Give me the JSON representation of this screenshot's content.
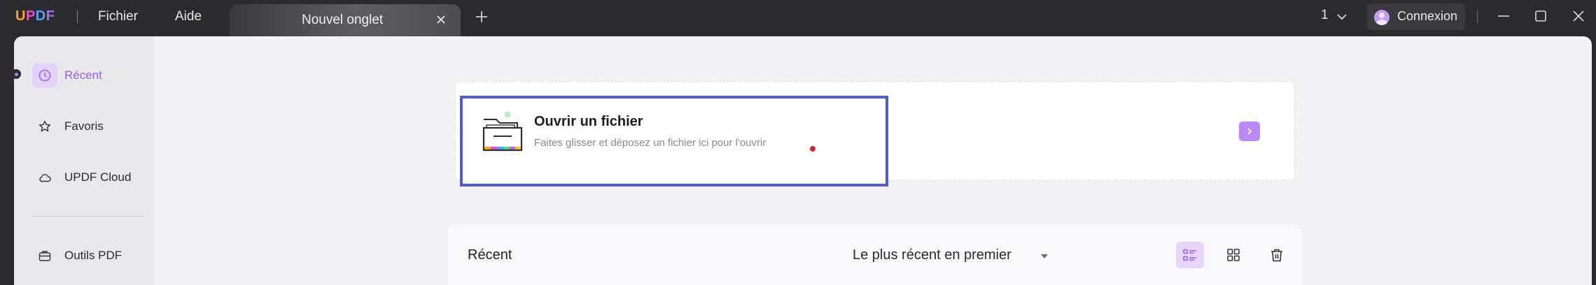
{
  "app": {
    "logo": {
      "u": "U",
      "p": "P",
      "d": "D",
      "f": "F"
    },
    "menu": {
      "fichier": "Fichier",
      "aide": "Aide"
    },
    "tab": {
      "label": "Nouvel onglet"
    },
    "page_number": "1",
    "login": {
      "label": "Connexion"
    }
  },
  "sidebar": {
    "items": [
      {
        "label": "Récent",
        "icon": "clock-icon",
        "active": true
      },
      {
        "label": "Favoris",
        "icon": "star-icon"
      },
      {
        "label": "UPDF Cloud",
        "icon": "cloud-icon"
      },
      {
        "label": "Outils PDF",
        "icon": "toolbox-icon"
      }
    ]
  },
  "open_file": {
    "title": "Ouvrir un fichier",
    "subtitle": "Faites glisser et déposez un fichier ici pour l'ouvrir"
  },
  "recent": {
    "title": "Récent",
    "sort": "Le plus récent en premier"
  },
  "colors": {
    "accent": "#9b5cf0",
    "highlight_border": "#4f5bdb",
    "titlebar": "#2b2b2d"
  }
}
